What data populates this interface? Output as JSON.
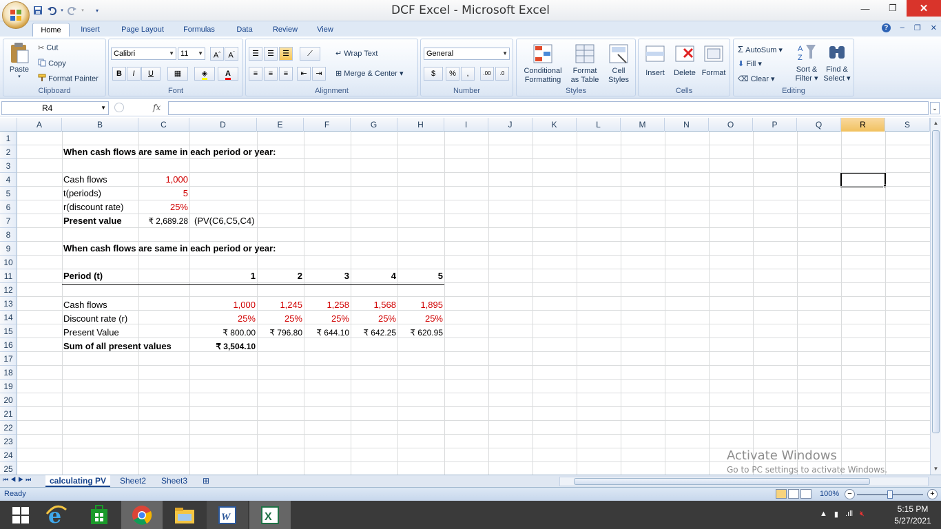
{
  "window": {
    "title": "DCF Excel - Microsoft Excel",
    "minimize": "—",
    "restore": "❐",
    "close": "✕"
  },
  "ribbon_tabs": [
    "Home",
    "Insert",
    "Page Layout",
    "Formulas",
    "Data",
    "Review",
    "View"
  ],
  "clipboard": {
    "paste": "Paste",
    "cut": "Cut",
    "copy": "Copy",
    "format_painter": "Format Painter",
    "label": "Clipboard"
  },
  "font": {
    "name": "Calibri",
    "size": "11",
    "label": "Font",
    "bold": "B",
    "italic": "I",
    "underline": "U"
  },
  "alignment": {
    "wrap_text": "Wrap Text",
    "merge_center": "Merge & Center",
    "label": "Alignment"
  },
  "number": {
    "format": "General",
    "currency": "$",
    "percent": "%",
    "comma": ",",
    "label": "Number"
  },
  "styles": {
    "conditional": "Conditional",
    "conditional2": "Formatting",
    "format_as": "Format",
    "format_as2": "as Table",
    "cell": "Cell",
    "cell2": "Styles",
    "label": "Styles"
  },
  "cells": {
    "insert": "Insert",
    "delete": "Delete",
    "format": "Format",
    "label": "Cells"
  },
  "editing": {
    "autosum": "AutoSum",
    "fill": "Fill",
    "clear": "Clear",
    "sort": "Sort &",
    "sort2": "Filter",
    "find": "Find &",
    "find2": "Select",
    "label": "Editing"
  },
  "formula_bar": {
    "name_box": "R4",
    "fx": "fx",
    "formula": ""
  },
  "columns": [
    "A",
    "B",
    "C",
    "D",
    "E",
    "F",
    "G",
    "H",
    "I",
    "J",
    "K",
    "L",
    "M",
    "N",
    "O",
    "P",
    "Q",
    "R",
    "S"
  ],
  "rows": [
    "1",
    "2",
    "3",
    "4",
    "5",
    "6",
    "7",
    "8",
    "9",
    "10",
    "11",
    "12",
    "13",
    "14",
    "15",
    "16",
    "17",
    "18",
    "19",
    "20",
    "21",
    "22",
    "23",
    "24",
    "25"
  ],
  "cells_data": {
    "b2": "When cash flows are same in each period or year:",
    "b4": "Cash flows",
    "c4": "1,000",
    "b5": "t(periods)",
    "c5": "5",
    "b6": "r(discount rate)",
    "c6": "25%",
    "b7": "Present value",
    "c7": "₹ 2,689.28",
    "d7": "(PV(C6,C5,C4)",
    "b9": "When cash flows are same in each period or year:",
    "b11": "Period (t)",
    "d11": "1",
    "e11": "2",
    "f11": "3",
    "g11": "4",
    "h11": "5",
    "b13": "Cash flows",
    "d13": "1,000",
    "e13": "1,245",
    "f13": "1,258",
    "g13": "1,568",
    "h13": "1,895",
    "b14": "Discount rate (r)",
    "d14": "25%",
    "e14": "25%",
    "f14": "25%",
    "g14": "25%",
    "h14": "25%",
    "b15": "Present Value",
    "d15": "₹ 800.00",
    "e15": "₹ 796.80",
    "f15": "₹ 644.10",
    "g15": "₹ 642.25",
    "h15": "₹ 620.95",
    "b16": "Sum of all present values",
    "d16": "₹ 3,504.10"
  },
  "watermark": {
    "line1": "Activate Windows",
    "line2": "Go to PC settings to activate Windows."
  },
  "sheets": [
    "calculating PV",
    "Sheet2",
    "Sheet3"
  ],
  "status": {
    "ready": "Ready",
    "zoom": "100%"
  },
  "taskbar": {
    "time": "5:15 PM",
    "date": "5/27/2021"
  }
}
